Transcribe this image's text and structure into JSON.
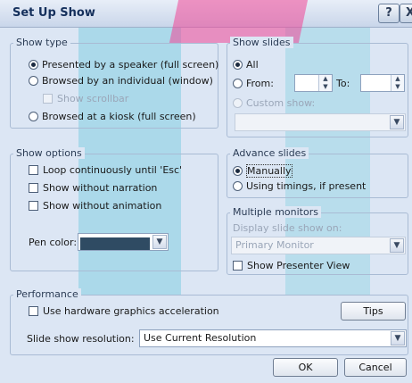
{
  "window": {
    "title": "Set Up Show",
    "help_glyph": "?",
    "close_glyph": "X"
  },
  "show_type": {
    "legend": "Show type",
    "options": [
      "Presented by a speaker (full screen)",
      "Browsed by an individual (window)",
      "Browsed at a kiosk (full screen)"
    ],
    "selected": 0,
    "show_scrollbar": "Show scrollbar"
  },
  "show_slides": {
    "legend": "Show slides",
    "all": "All",
    "from": "From:",
    "to": "To:",
    "custom_show": "Custom show:",
    "selected": "all"
  },
  "show_options": {
    "legend": "Show options",
    "loop": "Loop continuously until 'Esc'",
    "no_narration": "Show without narration",
    "no_animation": "Show without animation",
    "pen_color_label": "Pen color:",
    "pen_color": "#2f4b63"
  },
  "advance_slides": {
    "legend": "Advance slides",
    "manually": "Manually",
    "timings": "Using timings, if present",
    "selected": "manually"
  },
  "multiple_monitors": {
    "legend": "Multiple monitors",
    "display_on": "Display slide show on:",
    "monitor": "Primary Monitor",
    "presenter_view": "Show Presenter View"
  },
  "performance": {
    "legend": "Performance",
    "hw_accel": "Use hardware graphics acceleration",
    "tips": "Tips",
    "resolution_label": "Slide show resolution:",
    "resolution": "Use Current Resolution"
  },
  "buttons": {
    "ok": "OK",
    "cancel": "Cancel"
  }
}
